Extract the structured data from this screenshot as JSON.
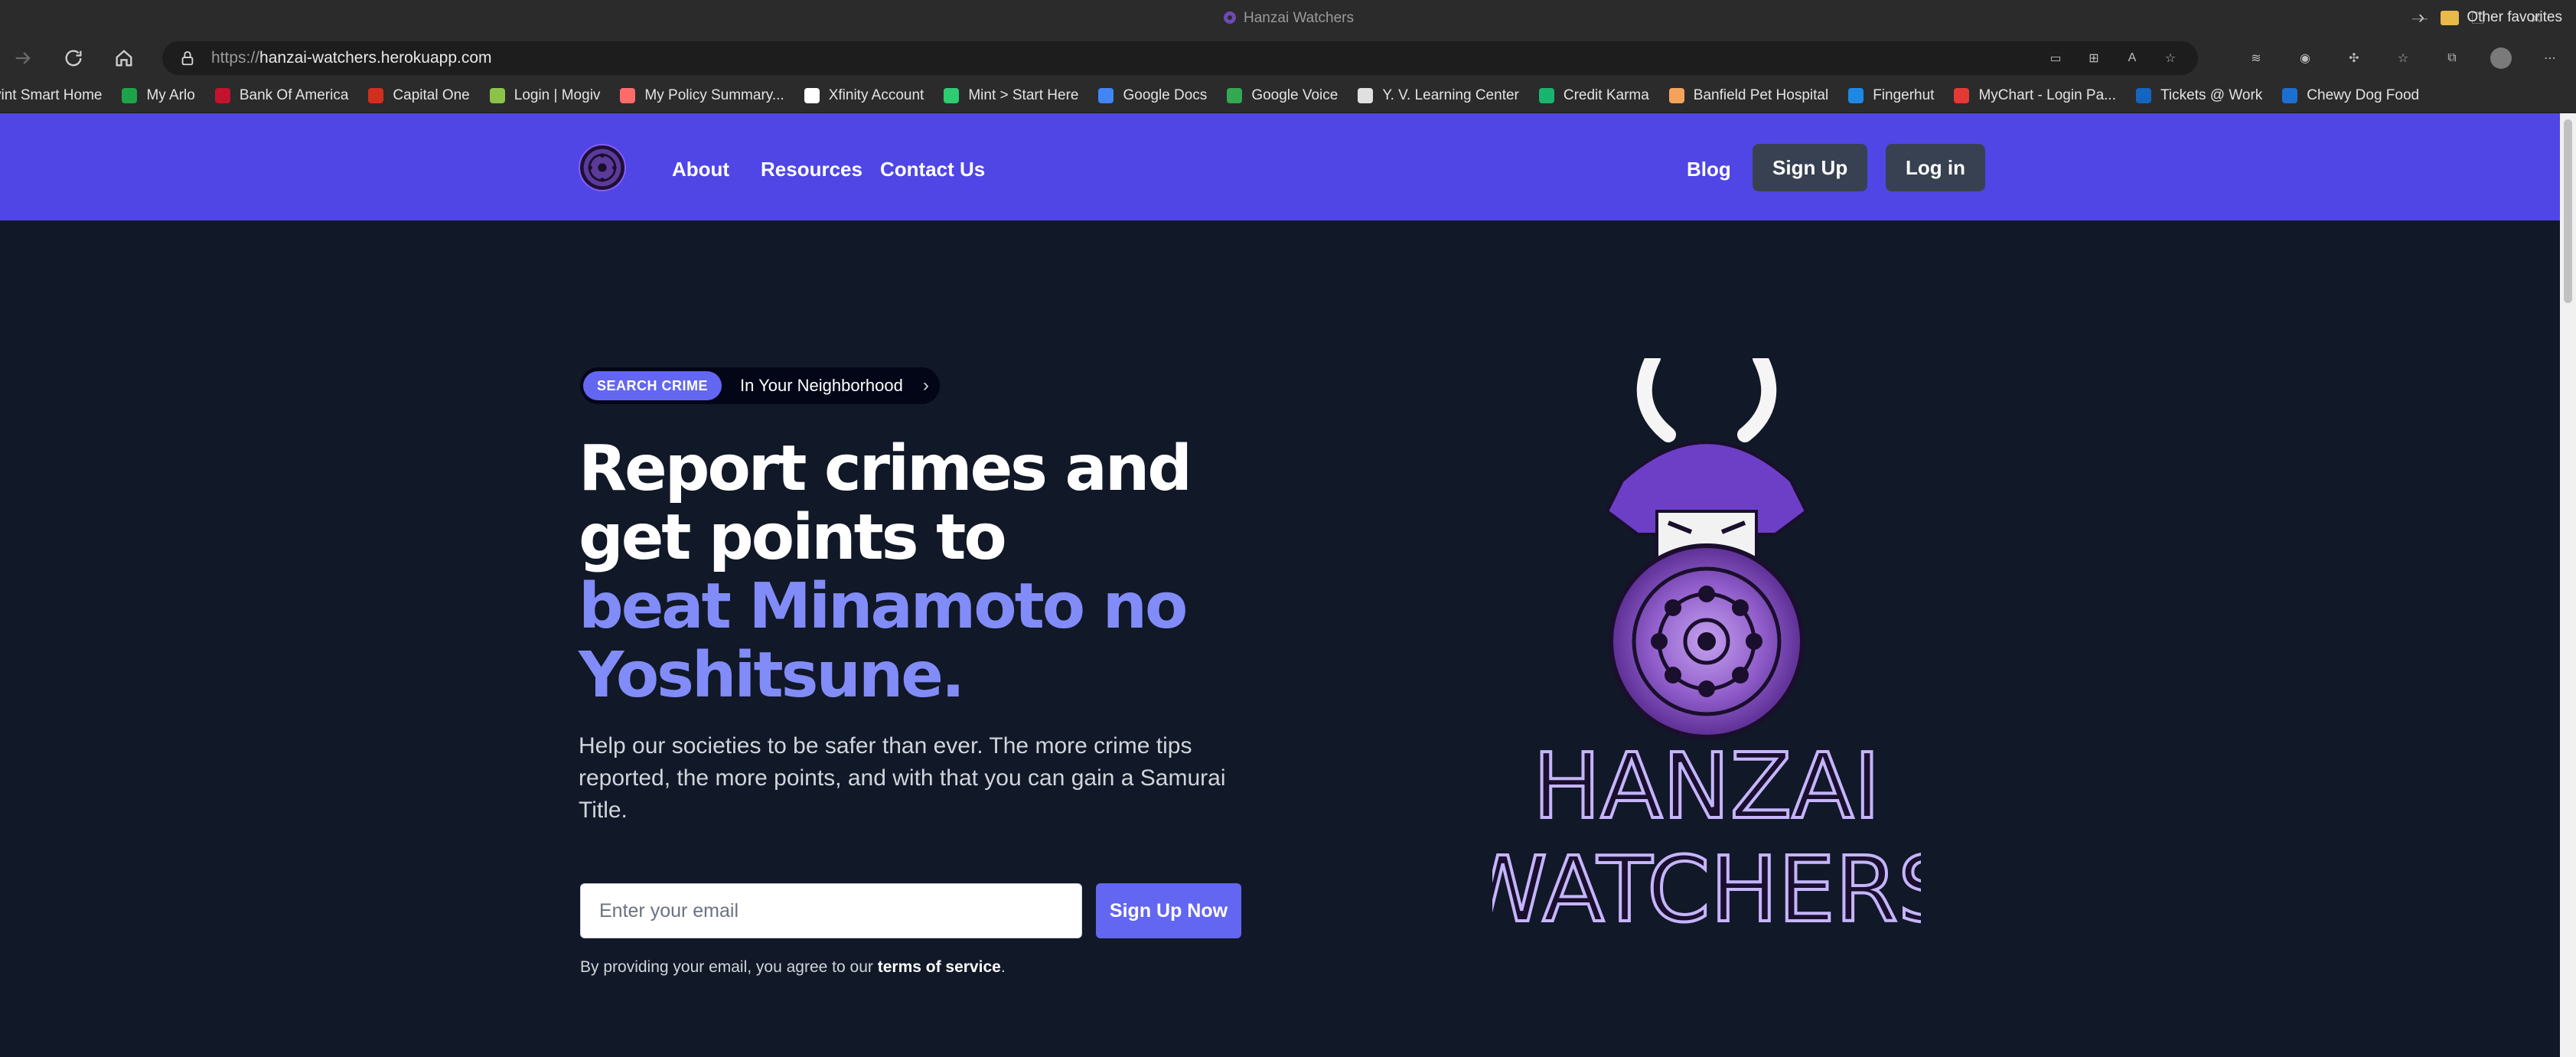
{
  "browser": {
    "window_title": "Hanzai Watchers",
    "url_prefix": "https://",
    "url_host": "hanzai-watchers.herokuapp.com",
    "bookmarks": [
      {
        "label": "vint Smart Home",
        "color": "#2b2b2b"
      },
      {
        "label": "My Arlo",
        "color": "#1fa34a"
      },
      {
        "label": "Bank Of America",
        "color": "#c4122f"
      },
      {
        "label": "Capital One",
        "color": "#d22e1e"
      },
      {
        "label": "Login | Mogiv",
        "color": "#8bc34a"
      },
      {
        "label": "My Policy Summary...",
        "color": "#ff6b6b"
      },
      {
        "label": "Xfinity Account",
        "color": "#ffffff"
      },
      {
        "label": "Mint > Start Here",
        "color": "#2ecc71"
      },
      {
        "label": "Google Docs",
        "color": "#4285f4"
      },
      {
        "label": "Google Voice",
        "color": "#34a853"
      },
      {
        "label": "Y. V. Learning Center",
        "color": "#e0e0e0"
      },
      {
        "label": "Credit Karma",
        "color": "#19b46e"
      },
      {
        "label": "Banfield Pet Hospital",
        "color": "#f5a25d"
      },
      {
        "label": "Fingerhut",
        "color": "#1e88e5"
      },
      {
        "label": "MyChart - Login Pa...",
        "color": "#e53935"
      },
      {
        "label": "Tickets @ Work",
        "color": "#1565c0"
      },
      {
        "label": "Chewy Dog Food",
        "color": "#1c6fd1"
      }
    ],
    "other_favorites": "Other favorites"
  },
  "nav": {
    "links": [
      "About",
      "Resources",
      "Contact Us"
    ],
    "blog": "Blog",
    "signup": "Sign Up",
    "login": "Log in"
  },
  "hero": {
    "badge_pill": "SEARCH CRIME",
    "badge_text": "In Your Neighborhood",
    "headline_line1": "Report crimes and",
    "headline_line2": "get points to",
    "headline_accent1": "beat Minamoto no",
    "headline_accent2": "Yoshitsune.",
    "lead": "Help our societies to be safer than ever. The more crime tips reported, the more points, and with that you can gain a Samurai Title.",
    "email_placeholder": "Enter your email",
    "cta": "Sign Up Now",
    "terms_prefix": "By providing your email, you agree to our ",
    "terms_link": "terms of service",
    "terms_suffix": "."
  },
  "art": {
    "wordmark_line1": "HANZAI",
    "wordmark_line2": "WATCHERS"
  },
  "colors": {
    "nav_bg": "#4f46e5",
    "page_bg": "#111827",
    "accent": "#818cf8",
    "cta": "#6366f1"
  }
}
